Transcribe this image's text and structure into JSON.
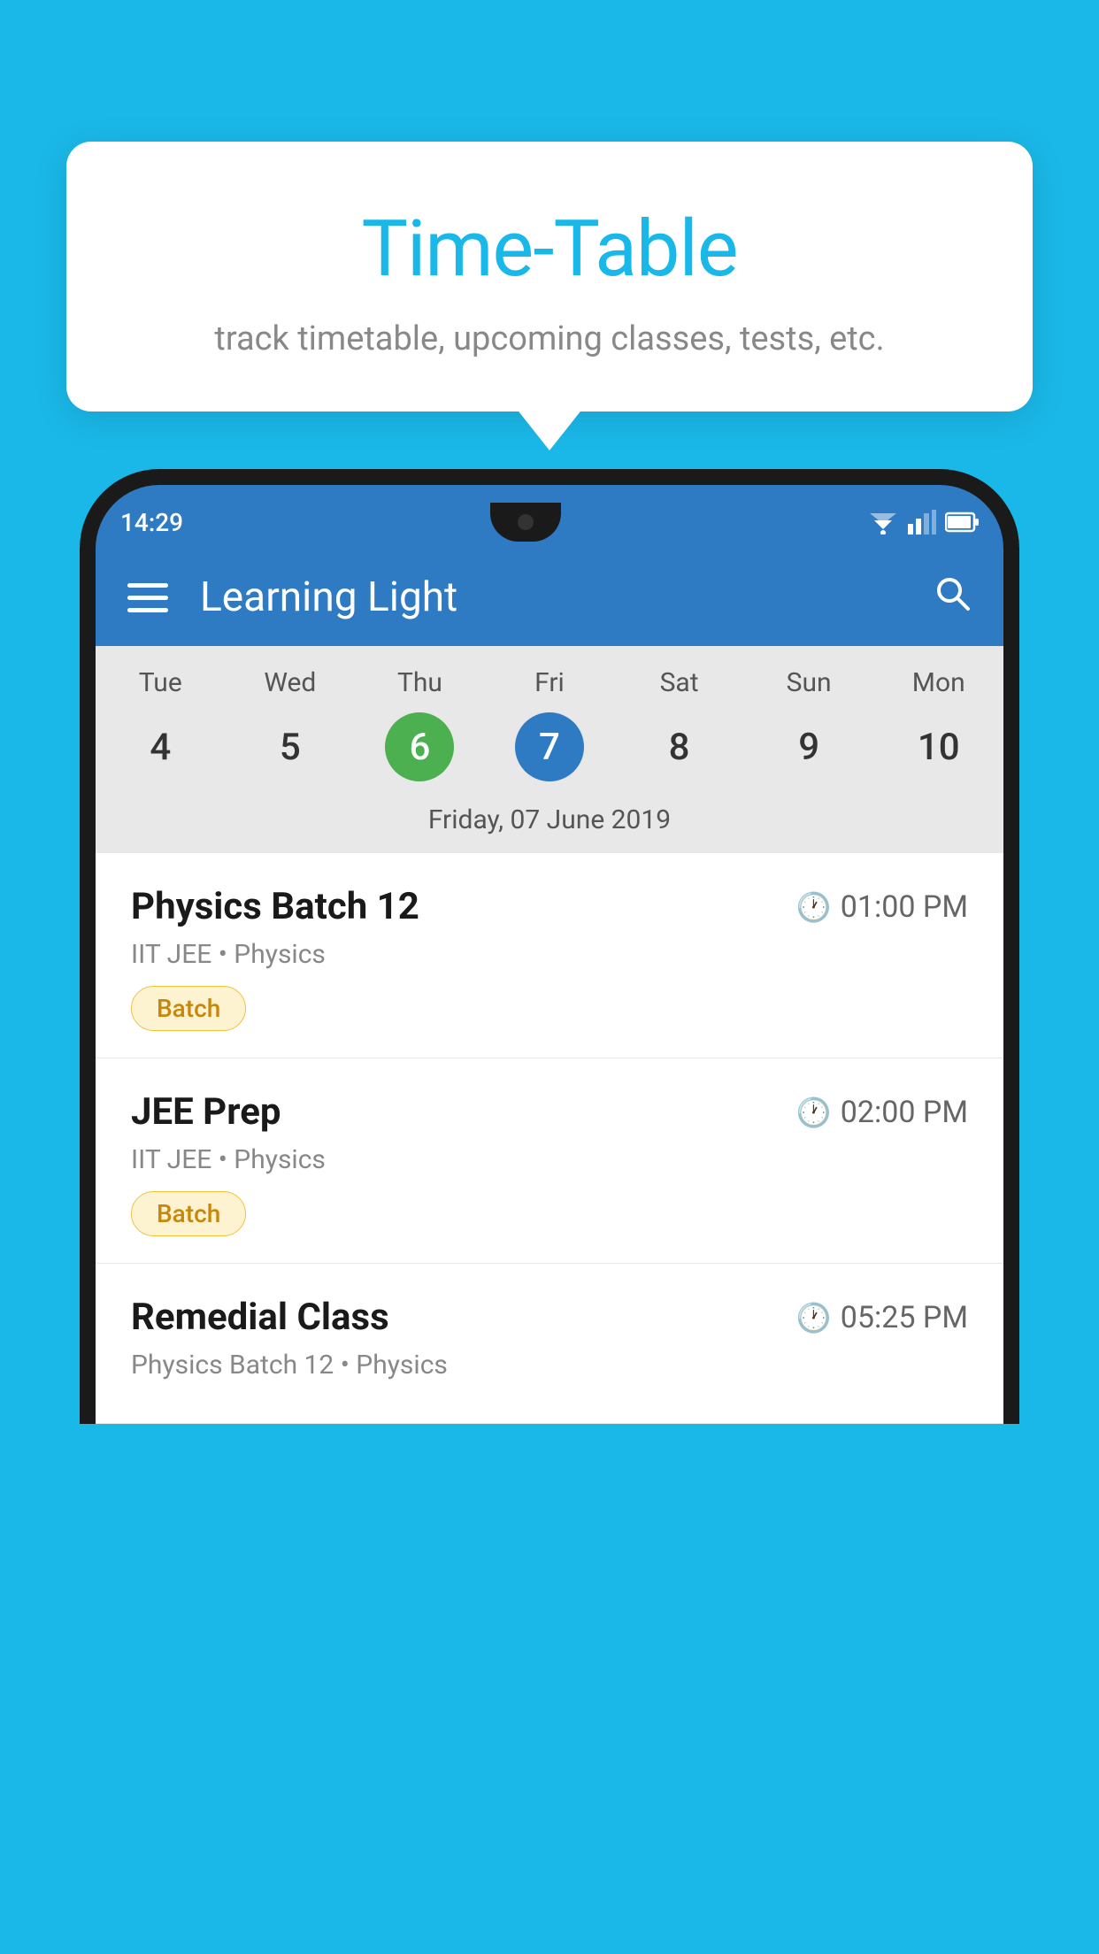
{
  "background_color": "#1ab8e8",
  "tooltip": {
    "title": "Time-Table",
    "subtitle": "track timetable, upcoming classes, tests, etc."
  },
  "status_bar": {
    "time": "14:29"
  },
  "app_bar": {
    "title": "Learning Light",
    "menu_label": "menu",
    "search_label": "search"
  },
  "calendar": {
    "selected_date_label": "Friday, 07 June 2019",
    "days": [
      {
        "label": "Tue",
        "num": "4",
        "type": "normal"
      },
      {
        "label": "Wed",
        "num": "5",
        "type": "normal"
      },
      {
        "label": "Thu",
        "num": "6",
        "type": "today"
      },
      {
        "label": "Fri",
        "num": "7",
        "type": "selected"
      },
      {
        "label": "Sat",
        "num": "8",
        "type": "normal"
      },
      {
        "label": "Sun",
        "num": "9",
        "type": "normal"
      },
      {
        "label": "Mon",
        "num": "10",
        "type": "normal"
      }
    ]
  },
  "schedule": [
    {
      "title": "Physics Batch 12",
      "time": "01:00 PM",
      "meta": "IIT JEE • Physics",
      "tag": "Batch"
    },
    {
      "title": "JEE Prep",
      "time": "02:00 PM",
      "meta": "IIT JEE • Physics",
      "tag": "Batch"
    },
    {
      "title": "Remedial Class",
      "time": "05:25 PM",
      "meta": "Physics Batch 12 • Physics",
      "tag": null
    }
  ]
}
